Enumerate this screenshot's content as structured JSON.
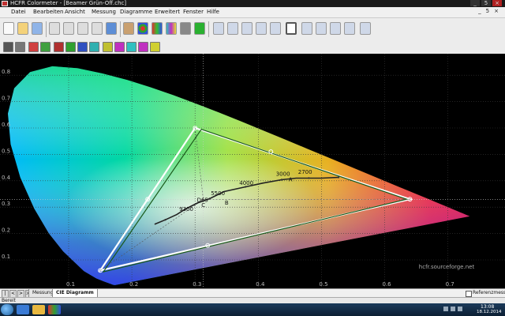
{
  "window": {
    "title": "HCFR Colormeter - [Beamer Grün-Off.chc]",
    "controls": [
      "_",
      "5",
      "×"
    ]
  },
  "menu": {
    "items": [
      "Datei",
      "Bearbeiten",
      "Ansicht",
      "Messung",
      "Diagramme",
      "Erweitert",
      "Fenster",
      "Hilfe"
    ],
    "window_controls": [
      "_",
      "5",
      "×"
    ]
  },
  "tabs": {
    "items": [
      "Messungen",
      "CIE Diagramm"
    ],
    "active": "CIE Diagramm",
    "nav": [
      "|<",
      "<",
      ">",
      ">|"
    ]
  },
  "reference": {
    "label": "Referenzmessung",
    "checked": false
  },
  "status": {
    "text": "Bereit"
  },
  "taskbar": {
    "time": "13:08",
    "date": "18.12.2014"
  },
  "chart_data": {
    "type": "scatter",
    "title": "",
    "xlabel": "",
    "ylabel": "",
    "xlim": [
      0.05,
      0.73
    ],
    "ylim": [
      0.0,
      0.87
    ],
    "x_ticks": [
      "0.1",
      "0.2",
      "0.3",
      "0.4",
      "0.5",
      "0.6",
      "0.7"
    ],
    "y_ticks": [
      "0.1",
      "0.2",
      "0.3",
      "0.4",
      "0.5",
      "0.6",
      "0.7",
      "0.8"
    ],
    "grid": true,
    "watermark": "hcfr.sourceforge.net",
    "crosshair": {
      "x": 0.313,
      "y": 0.329
    },
    "spectral_locus": [
      [
        0.1741,
        0.005
      ],
      [
        0.1738,
        0.0049
      ],
      [
        0.1733,
        0.0048
      ],
      [
        0.1726,
        0.0048
      ],
      [
        0.1714,
        0.0051
      ],
      [
        0.1689,
        0.0069
      ],
      [
        0.1644,
        0.0109
      ],
      [
        0.1566,
        0.0177
      ],
      [
        0.144,
        0.0297
      ],
      [
        0.1241,
        0.0578
      ],
      [
        0.0913,
        0.1327
      ],
      [
        0.0687,
        0.2007
      ],
      [
        0.0454,
        0.295
      ],
      [
        0.0235,
        0.4127
      ],
      [
        0.0082,
        0.5384
      ],
      [
        0.0039,
        0.6548
      ],
      [
        0.0139,
        0.7502
      ],
      [
        0.0389,
        0.812
      ],
      [
        0.0743,
        0.8338
      ],
      [
        0.1142,
        0.8262
      ],
      [
        0.1547,
        0.8059
      ],
      [
        0.1929,
        0.7816
      ],
      [
        0.2296,
        0.7543
      ],
      [
        0.2658,
        0.7243
      ],
      [
        0.3016,
        0.6923
      ],
      [
        0.3373,
        0.6589
      ],
      [
        0.3731,
        0.6245
      ],
      [
        0.4087,
        0.5896
      ],
      [
        0.4441,
        0.5547
      ],
      [
        0.4788,
        0.5202
      ],
      [
        0.5125,
        0.4866
      ],
      [
        0.5448,
        0.4544
      ],
      [
        0.5752,
        0.4242
      ],
      [
        0.6029,
        0.3965
      ],
      [
        0.627,
        0.3725
      ],
      [
        0.6482,
        0.3514
      ],
      [
        0.6658,
        0.334
      ],
      [
        0.6801,
        0.3197
      ],
      [
        0.6915,
        0.3083
      ],
      [
        0.7006,
        0.2993
      ],
      [
        0.7079,
        0.292
      ],
      [
        0.714,
        0.2859
      ],
      [
        0.719,
        0.2809
      ],
      [
        0.723,
        0.277
      ],
      [
        0.726,
        0.274
      ],
      [
        0.7283,
        0.2717
      ],
      [
        0.73,
        0.27
      ],
      [
        0.7311,
        0.2689
      ],
      [
        0.732,
        0.268
      ],
      [
        0.7327,
        0.2673
      ],
      [
        0.7334,
        0.2666
      ],
      [
        0.734,
        0.266
      ],
      [
        0.7344,
        0.2656
      ],
      [
        0.7346,
        0.2654
      ],
      [
        0.7347,
        0.2653
      ]
    ],
    "reference_gamut": [
      [
        0.64,
        0.33
      ],
      [
        0.3,
        0.6
      ],
      [
        0.15,
        0.06
      ]
    ],
    "measured_gamut": [
      [
        0.635,
        0.33
      ],
      [
        0.31,
        0.595
      ],
      [
        0.155,
        0.055
      ]
    ],
    "secondaries": [
      [
        0.42,
        0.51
      ],
      [
        0.225,
        0.33
      ],
      [
        0.32,
        0.155
      ]
    ],
    "planckian_locus": [
      [
        0.236,
        0.235
      ],
      [
        0.253,
        0.252
      ],
      [
        0.271,
        0.272
      ],
      [
        0.285,
        0.293
      ],
      [
        0.304,
        0.316
      ],
      [
        0.323,
        0.332
      ],
      [
        0.346,
        0.359
      ],
      [
        0.38,
        0.377
      ],
      [
        0.407,
        0.391
      ],
      [
        0.437,
        0.404
      ],
      [
        0.46,
        0.41
      ],
      [
        0.48,
        0.41
      ],
      [
        0.5,
        0.41
      ],
      [
        0.527,
        0.413
      ]
    ],
    "cct_labels": [
      {
        "text": "9300",
        "x": 0.275,
        "y": 0.285
      },
      {
        "text": "D65",
        "x": 0.303,
        "y": 0.32
      },
      {
        "text": "5500",
        "x": 0.325,
        "y": 0.345
      },
      {
        "text": "4000",
        "x": 0.37,
        "y": 0.385
      },
      {
        "text": "3000",
        "x": 0.428,
        "y": 0.419
      },
      {
        "text": "2700",
        "x": 0.463,
        "y": 0.426
      },
      {
        "text": "C",
        "x": 0.31,
        "y": 0.3
      },
      {
        "text": "B",
        "x": 0.347,
        "y": 0.31
      },
      {
        "text": "A",
        "x": 0.448,
        "y": 0.398
      }
    ]
  }
}
